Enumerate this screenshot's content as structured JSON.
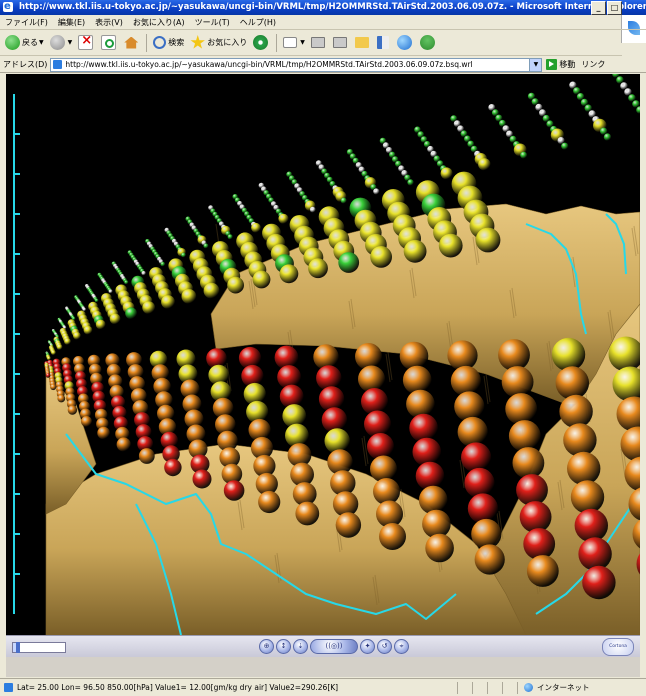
{
  "window": {
    "title": "http://www.tkl.iis.u-tokyo.ac.jp/~yasukawa/uncgi-bin/VRML/tmp/H2OMMRStd.TAirStd.2003.06.09.07z. - Microsoft Internet Explorer",
    "min_label": "_",
    "max_label": "□"
  },
  "menu": [
    "ファイル(F)",
    "編集(E)",
    "表示(V)",
    "お気に入り(A)",
    "ツール(T)",
    "ヘルプ(H)"
  ],
  "toolbar": {
    "back_label": "戻る",
    "search_label": "検索",
    "favorites_label": "お気に入り"
  },
  "address": {
    "label": "アドレス(D)",
    "url": "http://www.tkl.iis.u-tokyo.ac.jp/~yasukawa/uncgi-bin/VRML/tmp/H2OMMRStd.TAirStd.2003.06.09.07z.bsq.wrl",
    "go_label": "移動",
    "links_label": "リンク"
  },
  "viewer": {
    "colors": {
      "background": "#000000",
      "terrain": "#c9a558",
      "terrain_light": "#e7c77f",
      "terrain_dark": "#7a5f28",
      "grid_line": "#27d8e8",
      "sphere_red": "#e0201a",
      "sphere_orange": "#e88a1e",
      "sphere_yellow": "#e7e12a",
      "sphere_green": "#3ad13a",
      "sphere_white": "#f0f0f0"
    }
  },
  "navigator": {
    "progress": 0.1,
    "logo_text": "Cortona"
  },
  "status": {
    "text": "Lat= 25.00  Lon= 96.50  850.00[hPa]  Value1= 12.00[gm/kg dry air]  Value2=290.26[K]",
    "zone_label": "インターネット"
  }
}
